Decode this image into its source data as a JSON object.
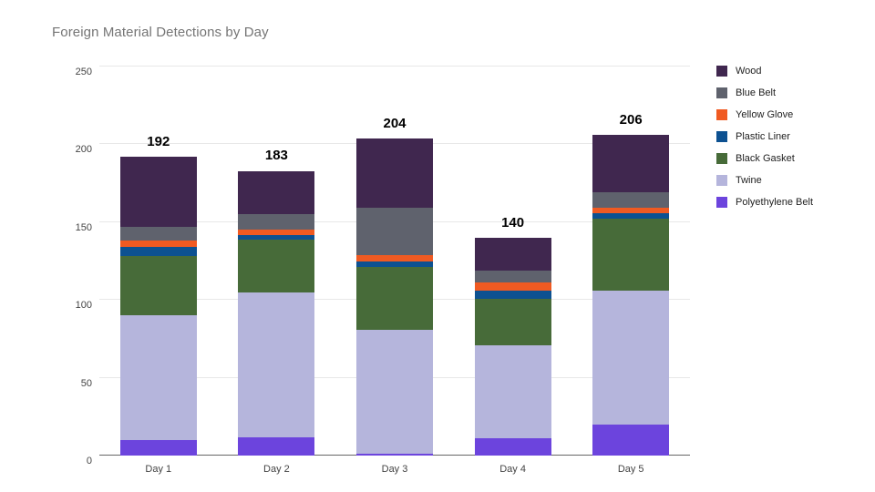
{
  "chart_data": {
    "type": "bar",
    "subtype": "stacked-bar",
    "title": "Foreign Material Detections by Day",
    "xlabel": "",
    "ylabel": "",
    "ylim": [
      0,
      250
    ],
    "yticks": [
      0,
      50,
      100,
      150,
      200,
      250
    ],
    "grid": true,
    "legend_position": "right",
    "categories": [
      "Day 1",
      "Day 2",
      "Day 3",
      "Day 4",
      "Day 5"
    ],
    "totals": [
      192,
      183,
      204,
      140,
      206
    ],
    "stack_order_bottom_to_top": [
      "Polyethylene Belt",
      "Twine",
      "Black Gasket",
      "Plastic Liner",
      "Yellow Glove",
      "Blue Belt",
      "Wood"
    ],
    "series": [
      {
        "name": "Wood",
        "color": "#40274f",
        "values": [
          45,
          28,
          45,
          21,
          37
        ]
      },
      {
        "name": "Blue Belt",
        "color": "#5f626d",
        "values": [
          9,
          10,
          30,
          8,
          10
        ]
      },
      {
        "name": "Yellow Glove",
        "color": "#f05a22",
        "values": [
          4,
          3,
          4,
          5,
          3
        ]
      },
      {
        "name": "Plastic Liner",
        "color": "#0d5191",
        "values": [
          6,
          3,
          4,
          5,
          4
        ]
      },
      {
        "name": "Black Gasket",
        "color": "#476b39",
        "values": [
          38,
          34,
          40,
          30,
          46
        ]
      },
      {
        "name": "Twine",
        "color": "#b5b5dc",
        "values": [
          80,
          93,
          80,
          60,
          86
        ]
      },
      {
        "name": "Polyethylene Belt",
        "color": "#6c44dd",
        "values": [
          10,
          12,
          1,
          11,
          20
        ]
      }
    ]
  },
  "legend": {
    "items": [
      {
        "label": "Wood",
        "icon": "legend-swatch-wood"
      },
      {
        "label": "Blue Belt",
        "icon": "legend-swatch-blue-belt"
      },
      {
        "label": "Yellow Glove",
        "icon": "legend-swatch-yellow-glove"
      },
      {
        "label": "Plastic Liner",
        "icon": "legend-swatch-plastic-liner"
      },
      {
        "label": "Black Gasket",
        "icon": "legend-swatch-black-gasket"
      },
      {
        "label": "Twine",
        "icon": "legend-swatch-twine"
      },
      {
        "label": "Polyethylene Belt",
        "icon": "legend-swatch-polyethylene-belt"
      }
    ]
  },
  "colors": {
    "background": "#ffffff",
    "gridline": "#e8e8e8",
    "axis": "#666666",
    "title_text": "#757575",
    "tick_text": "#444444",
    "total_label_text": "#000000"
  }
}
